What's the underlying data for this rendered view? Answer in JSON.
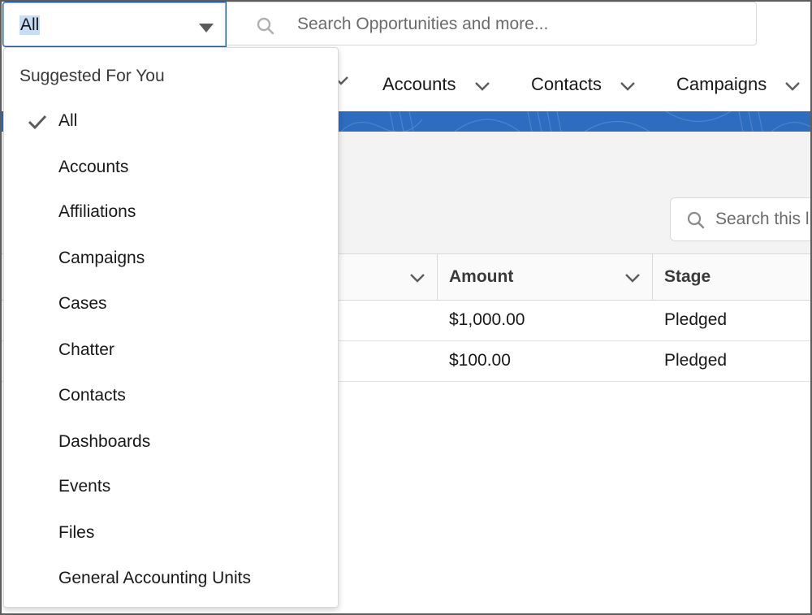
{
  "search_bar": {
    "scope_value": "All",
    "search_placeholder": "Search Opportunities and more..."
  },
  "nav": {
    "items": [
      {
        "label": "Accounts"
      },
      {
        "label": "Contacts"
      },
      {
        "label": "Campaigns"
      }
    ]
  },
  "list_view": {
    "search_placeholder": "Search this list..."
  },
  "table": {
    "columns": [
      "",
      "Amount",
      "Stage"
    ],
    "rows": [
      {
        "amount": "$1,000.00",
        "stage": "Pledged"
      },
      {
        "amount": "$100.00",
        "stage": "Pledged"
      }
    ]
  },
  "dropdown": {
    "heading": "Suggested For You",
    "selected": "All",
    "items": [
      {
        "label": "All"
      },
      {
        "label": "Accounts"
      },
      {
        "label": "Affiliations"
      },
      {
        "label": "Campaigns"
      },
      {
        "label": "Cases"
      },
      {
        "label": "Chatter"
      },
      {
        "label": "Contacts"
      },
      {
        "label": "Dashboards"
      },
      {
        "label": "Events"
      },
      {
        "label": "Files"
      },
      {
        "label": "General Accounting Units"
      }
    ]
  },
  "colors": {
    "brand_band": "#2e6cbf",
    "focus_border": "#1b5aa8",
    "selection_highlight": "#c7dcf5"
  }
}
